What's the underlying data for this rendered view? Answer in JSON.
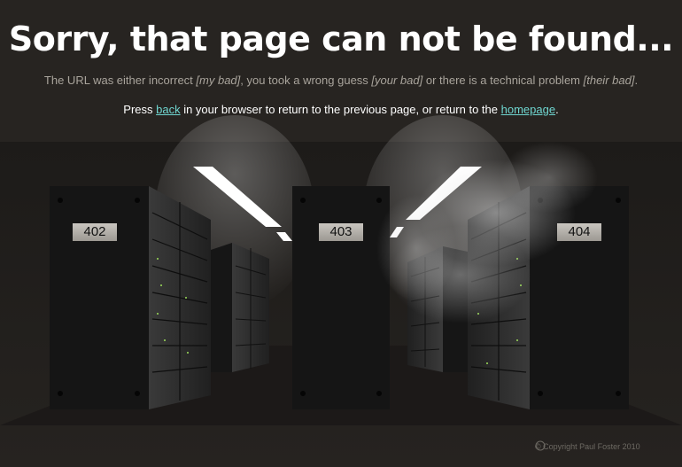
{
  "header": {
    "title": "Sorry, that page can not be found...",
    "subtitle": {
      "part1": "The URL was either incorrect ",
      "em1": "[my bad]",
      "part2": ", you took a wrong guess ",
      "em2": "[your bad]",
      "part3": " or there is a technical problem ",
      "em3": "[their bad]",
      "part4": "."
    },
    "press": {
      "part1": "Press ",
      "back_link": "back",
      "part2": " in your browser to return to the previous page, or return to the ",
      "homepage_link": "homepage",
      "part3": "."
    }
  },
  "servers": {
    "left_label": "402",
    "center_label": "403",
    "right_label": "404"
  },
  "footer": {
    "copyright": "© Copyright Paul Foster 2010"
  },
  "colors": {
    "background": "#272421",
    "link": "#6fd6d0",
    "subtitle_text": "#a9a49c",
    "rack_front": "#151515"
  }
}
